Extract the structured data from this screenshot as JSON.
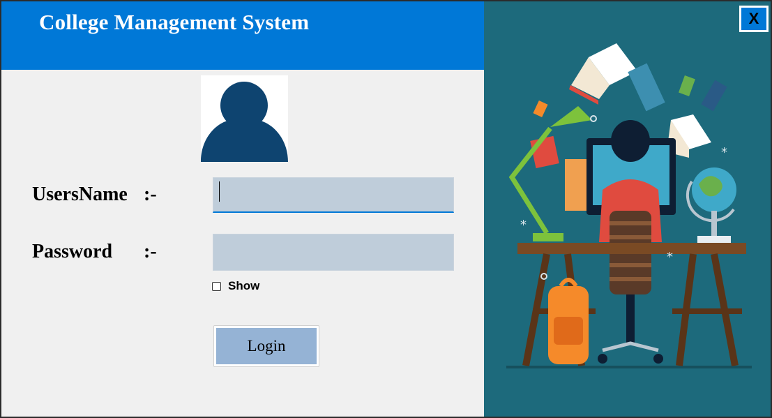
{
  "header": {
    "title": "College Management System"
  },
  "form": {
    "username_label": "UsersName",
    "username_sep": ":-",
    "username_value": "",
    "password_label": "Password",
    "password_sep": ":-",
    "password_value": "",
    "show_label": "Show",
    "show_checked": false,
    "login_label": "Login"
  },
  "window": {
    "close_label": "X"
  },
  "colors": {
    "header_blue": "#0078d7",
    "input_bg": "#bfcdda",
    "login_bg": "#95b3d5",
    "illustration_bg": "#1d6a7c"
  },
  "icons": {
    "avatar": "user-avatar-icon",
    "illustration": "student-studying-illustration"
  }
}
